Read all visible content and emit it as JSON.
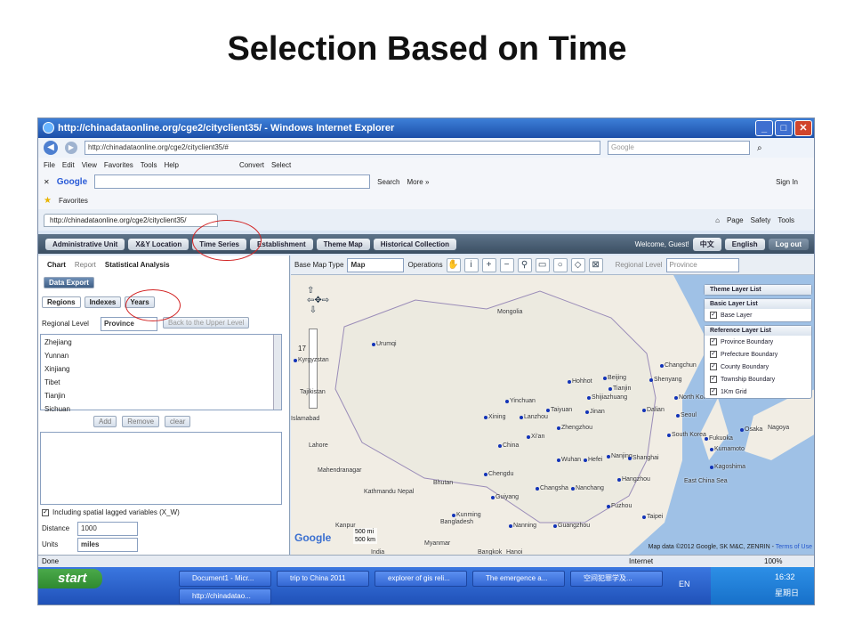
{
  "slide_title": "Selection Based on Time",
  "window": {
    "title": "http://chinadataonline.org/cge2/cityclient35/ - Windows Internet Explorer",
    "address": "http://chinadataonline.org/cge2/cityclient35/#",
    "search_placeholder": "Google"
  },
  "menu": [
    "File",
    "Edit",
    "View",
    "Favorites",
    "Tools",
    "Help"
  ],
  "menu_extra": {
    "convert": "Convert",
    "select": "Select"
  },
  "google_bar": {
    "logo": "Google",
    "search": "Search",
    "more": "More »",
    "signin": "Sign In"
  },
  "favorites": {
    "label": "Favorites",
    "tab": "http://chinadataonline.org/cge2/cityclient35/"
  },
  "ie_cmd": {
    "page": "Page",
    "safety": "Safety",
    "tools": "Tools"
  },
  "nav_tabs": [
    "Administrative Unit",
    "X&Y Location",
    "Time Series",
    "Establishment",
    "Theme Map",
    "Historical Collection"
  ],
  "nav_right": {
    "welcome": "Welcome, Guest!",
    "chinese": "中文",
    "english": "English",
    "logout": "Log out"
  },
  "left": {
    "chart": "Chart",
    "report": "Report",
    "stat": "Statistical Analysis",
    "export": "Data Export",
    "tabs": [
      "Regions",
      "Indexes",
      "Years"
    ],
    "regional_level_label": "Regional Level",
    "regional_level": "Province",
    "back": "Back to the Upper Level",
    "regions": [
      "Zhejiang",
      "Yunnan",
      "Xinjiang",
      "Tibet",
      "Tianjin",
      "Sichuan"
    ],
    "add": "Add",
    "remove": "Remove",
    "clear": "clear",
    "spatial_lag": "Including spatial lagged variables (X_W)",
    "distance_label": "Distance",
    "distance": "1000",
    "units_label": "Units",
    "units": "miles"
  },
  "map": {
    "base_type_label": "Base Map Type",
    "base_type": "Map",
    "operations": "Operations",
    "regional_level_label": "Regional Level",
    "regional_level": "Province",
    "zoom_label": "17",
    "labels": [
      "Mongolia",
      "Urumqi",
      "Kyrgyzstan",
      "Hohhot",
      "Beijing",
      "Tianjin",
      "Shijiazhuang",
      "Yinchuan",
      "Lanzhou",
      "Xining",
      "Taiyuan",
      "Jinan",
      "Xi'an",
      "Zhengzhou",
      "China",
      "Chengdu",
      "Wuhan",
      "Hefei",
      "Nanjing",
      "Shanghai",
      "Hangzhou",
      "Changsha",
      "Nanchang",
      "Guiyang",
      "Fuzhou",
      "Kunming",
      "Nanning",
      "Guangzhou",
      "Taipei",
      "Changchun",
      "Shenyang",
      "Dalian",
      "Seoul",
      "South Korea",
      "North Korea",
      "Japan",
      "Osaka",
      "Fukuoka",
      "Kumamoto",
      "Kagoshima",
      "Nagoya",
      "East China Sea",
      "Nepal",
      "Bhutan",
      "Bangladesh",
      "Mahendranagar",
      "Kathmandu",
      "Lahore",
      "Kanpur",
      "India",
      "Myanmar",
      "Bangkok",
      "Islamabad",
      "Tajikistan",
      "Hanoi"
    ],
    "scale": {
      "mi": "500 mi",
      "km": "500 km"
    },
    "copyright": "Map data ©2012 Google, SK M&C, ZENRIN -",
    "terms": "Terms of Use",
    "logo": "Google"
  },
  "layers": {
    "theme": "Theme Layer List",
    "basic": "Basic Layer List",
    "base_layer": "Base Layer",
    "reference": "Reference Layer List",
    "items": [
      "Province Boundary",
      "Prefecture Boundary",
      "County Boundary",
      "Township Boundary",
      "1Km Grid"
    ]
  },
  "status": {
    "left": "Done",
    "zone": "Internet",
    "zoom": "100%"
  },
  "taskbar": {
    "start": "start",
    "tasks": [
      "Document1 - Micr...",
      "trip to China 2011",
      "explorer of gis reli...",
      "The emergence a...",
      "空间犯罪学及..."
    ],
    "task2": "http://chinadatao...",
    "lang": "EN",
    "time": "16:32",
    "day": "星期日"
  },
  "annotation_color": "#d22222"
}
